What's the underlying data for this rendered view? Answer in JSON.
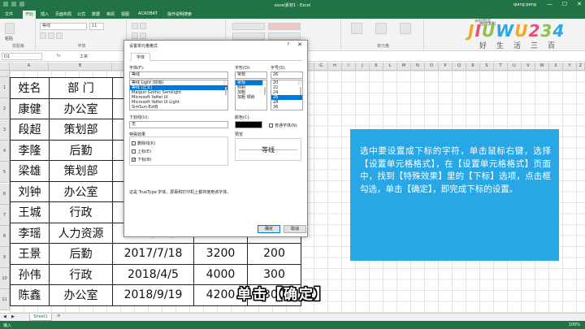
{
  "window": {
    "title": "excel素材1 - Excel",
    "user": "qiang peng",
    "min": "—",
    "max": "☐",
    "close": "✕"
  },
  "ribbon": {
    "tabs": [
      "文件",
      "开始",
      "插入",
      "页面布局",
      "公式",
      "数据",
      "审阅",
      "视图",
      "ACROBAT",
      "操作说明搜索"
    ],
    "active_tab": "开始",
    "font_name": "等线",
    "font_size": "11",
    "paste_label": "粘贴",
    "clipboard_label": "剪贴板",
    "font_group_label": "字体",
    "styles_label": "样式",
    "cells_label": "单元格",
    "sum_label": "自动求和"
  },
  "formula_bar": {
    "cell_ref": "D1",
    "fx": "fx",
    "value": "工资"
  },
  "columns": [
    "A",
    "B",
    "C",
    "D",
    "E",
    "F",
    "G",
    "H",
    "I",
    "J",
    "K",
    "L",
    "M",
    "N",
    "O",
    "P",
    "Q",
    "R",
    "S",
    "T",
    "U",
    "V",
    "W",
    "X",
    "Y",
    "Z",
    "AA",
    "AB",
    "AC",
    "AD",
    "AE",
    "AF",
    "AG",
    "AH",
    "AI",
    "AJ",
    "AK",
    "AL",
    "AM",
    "AN",
    "AO",
    "AP"
  ],
  "rows": [
    "1",
    "2",
    "3",
    "4",
    "5",
    "6",
    "7",
    "8",
    "9",
    "10",
    "11"
  ],
  "table": {
    "header": [
      "姓名",
      "部 门",
      "入职日期",
      "工资",
      "奖金"
    ],
    "rows": [
      [
        "康健",
        "办公室",
        "",
        "",
        ""
      ],
      [
        "段超",
        "策划部",
        "",
        "",
        ""
      ],
      [
        "李隆",
        "后勤",
        "",
        "",
        ""
      ],
      [
        "梁雄",
        "策划部",
        "",
        "",
        ""
      ],
      [
        "刘钟",
        "办公室",
        "",
        "",
        ""
      ],
      [
        "王城",
        "行政",
        "",
        "",
        ""
      ],
      [
        "李瑶",
        "人力资源",
        "2017/11/3",
        "6000",
        "300"
      ],
      [
        "王景",
        "后勤",
        "2017/7/18",
        "3200",
        "200"
      ],
      [
        "孙伟",
        "行政",
        "2018/4/5",
        "4000",
        "300"
      ],
      [
        "陈鑫",
        "办公室",
        "2018/9/19",
        "4200",
        "300"
      ]
    ]
  },
  "dialog": {
    "title": "设置单元格格式",
    "help": "?",
    "close": "✕",
    "tab": "字体",
    "font_label": "字体(F):",
    "font_value": "等线",
    "font_list": [
      "等线 Light (标题)",
      "等线 (正文)",
      "Malgun Gothic Semilight",
      "Microsoft YaHei UI",
      "Microsoft YaHei UI Light",
      "SimSun-ExtB"
    ],
    "style_label": "字形(O):",
    "style_value": "常规",
    "style_list": [
      "常规",
      "倾斜",
      "加粗",
      "加粗 倾斜"
    ],
    "size_label": "字号(S):",
    "size_value": "26",
    "size_list": [
      "20",
      "22",
      "24",
      "26",
      "28",
      "36"
    ],
    "underline_label": "下划线(U):",
    "underline_value": "无",
    "color_label": "颜色(C):",
    "normal_font": "普通字体(N)",
    "effects_label": "特殊效果",
    "strike_label": "删除线(K)",
    "super_label": "上标(E)",
    "sub_label": "下标(B)",
    "sub_checked": "✓",
    "preview_label": "预览",
    "preview_text": "等线",
    "info": "这是 TrueType 字体。屏幕和打印机上都将使用该字体。",
    "ok": "确定",
    "cancel": "取消"
  },
  "card_text": "选中要设置成下标的字符，单击鼠标右键，选择【设置单元格格式】，在【设置单元格格式】页面中，找到【特殊效果】里的【下标】选项，点击框勾选，单击【确定】，即完成下标的设置。",
  "subtitle": "单击【确定】",
  "sheet_tab": "Sheet1",
  "add_sheet": "⊕",
  "status": "输入",
  "zoom": "100%",
  "logo": {
    "text": "JIUWU234",
    "sub": "好生活三百",
    "small": "百科知识"
  },
  "colors": {
    "excel_green": "#217346",
    "card_blue": "#27a7e6",
    "selection_blue": "#0078d7"
  }
}
